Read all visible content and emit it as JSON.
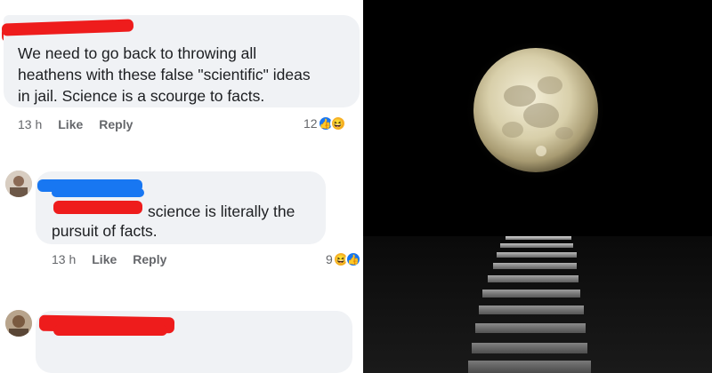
{
  "comments": [
    {
      "text": "We need to go back to throwing all heathens with these false \"scientific\" ideas in jail. Science is a scourge to facts.",
      "lines": [
        "We need to go back to throwing all",
        "heathens with these false \"scientific\" ideas",
        "in jail. Science is a scourge to facts."
      ],
      "time": "13 h",
      "like": "Like",
      "reply": "Reply",
      "reaction_count": "12",
      "reactions": [
        "like-icon",
        "haha-icon"
      ]
    },
    {
      "lines": [
        "science is literally the",
        "pursuit of facts."
      ],
      "time": "13 h",
      "like": "Like",
      "reply": "Reply",
      "reaction_count": "9",
      "reactions": [
        "haha-icon",
        "like-icon"
      ]
    },
    {
      "lines": []
    }
  ],
  "colors": {
    "redaction": "#ee1c1c",
    "bubble": "#f0f2f5",
    "link_blue": "#1877f2",
    "night_sky": "#000000"
  },
  "image": {
    "subject": "full-moon-over-ocean"
  }
}
